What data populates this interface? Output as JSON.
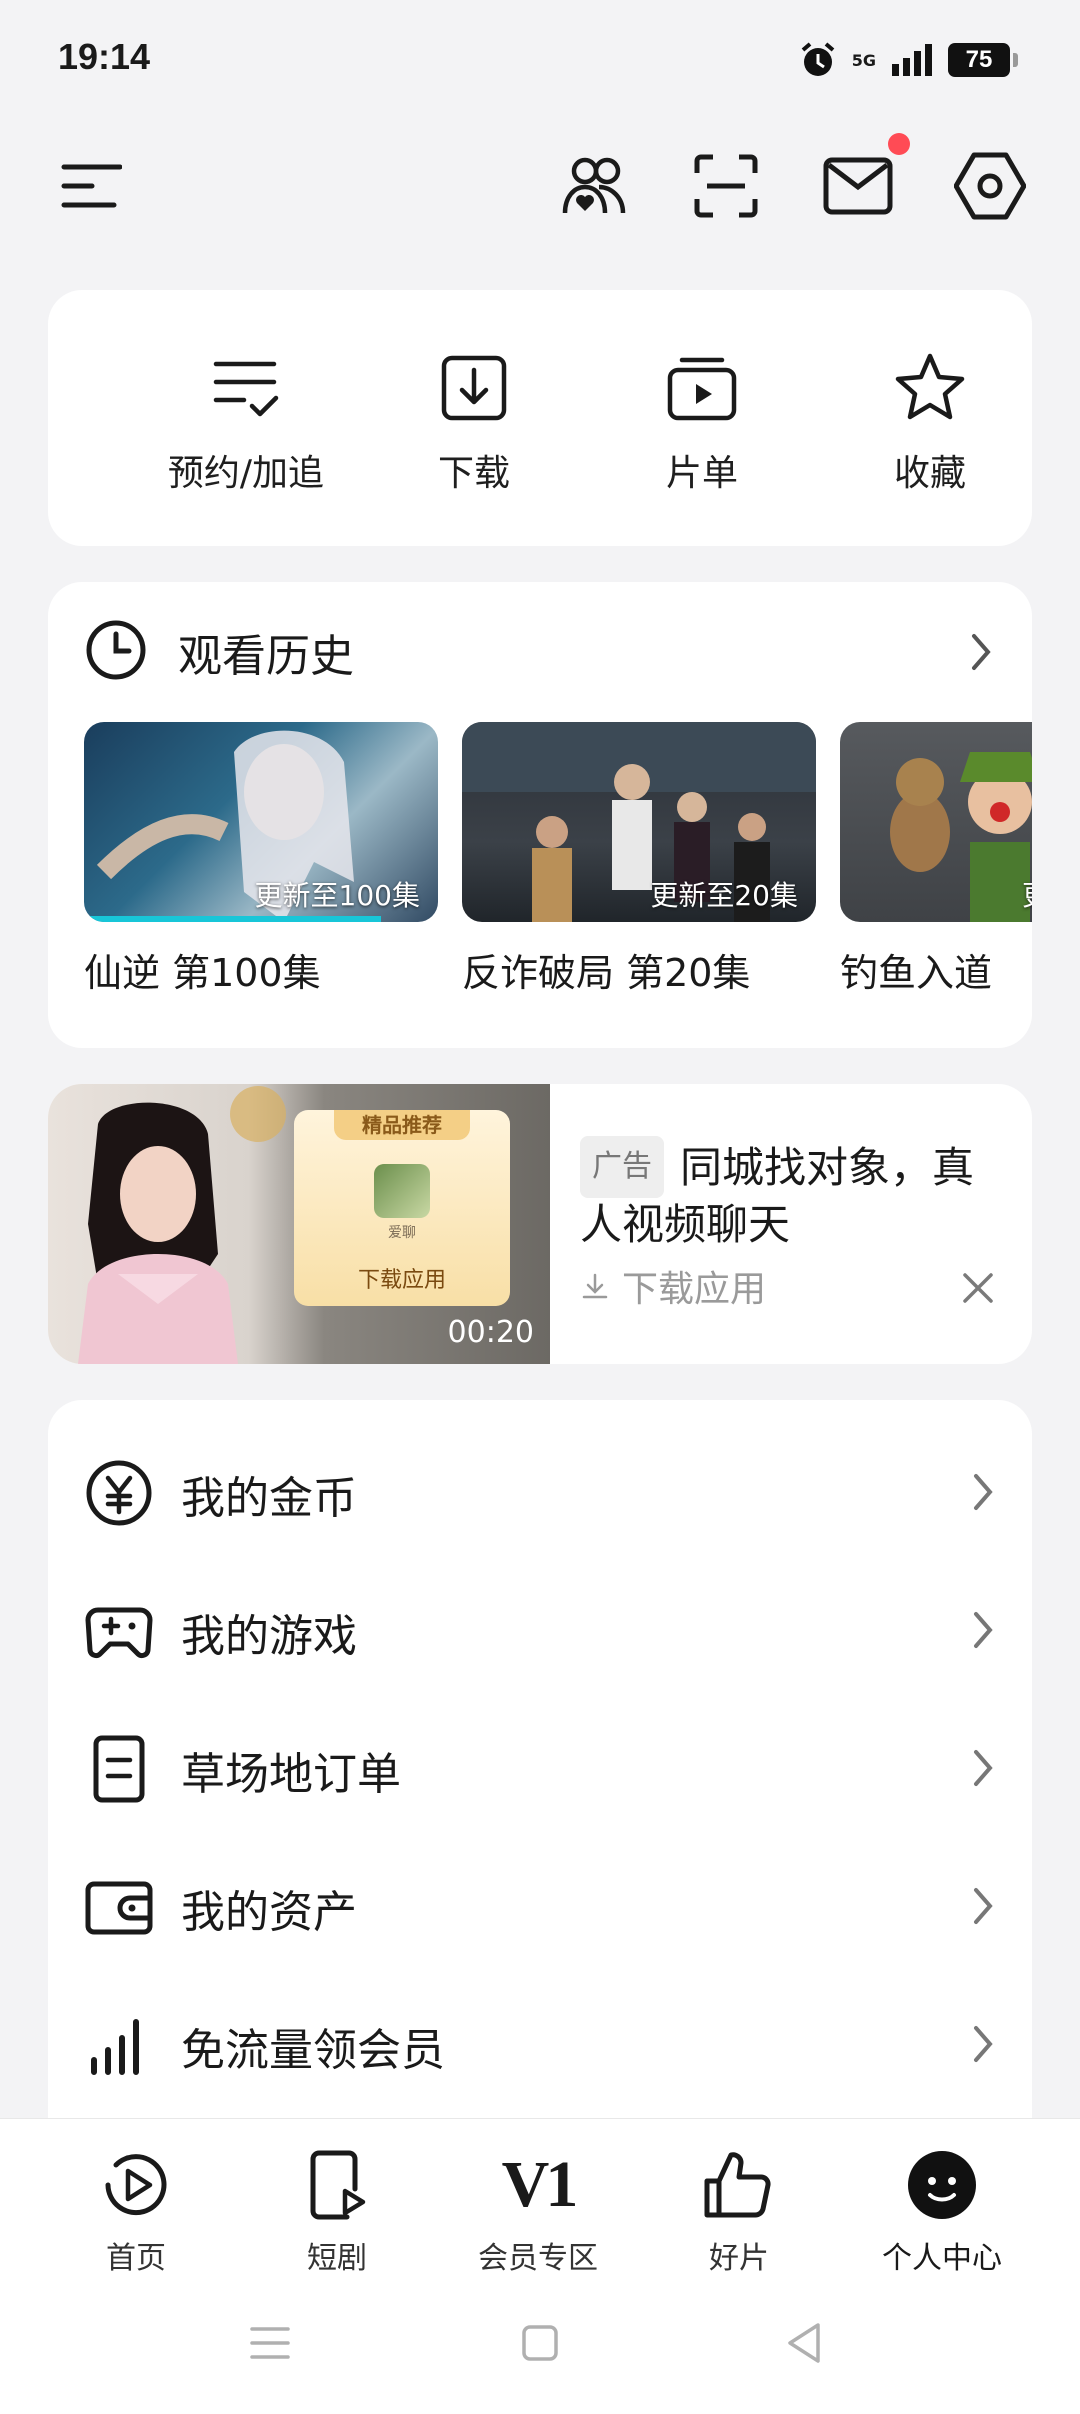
{
  "status_bar": {
    "time": "19:14",
    "network": "5G",
    "battery": "75"
  },
  "topbar": {
    "icons": [
      "menu-icon",
      "friends-icon",
      "scan-icon",
      "mail-icon",
      "settings-icon"
    ],
    "mail_has_badge": true
  },
  "quick_actions": [
    {
      "label": "预约/加追",
      "icon": "list-check-icon"
    },
    {
      "label": "下载",
      "icon": "download-icon"
    },
    {
      "label": "片单",
      "icon": "playlist-icon"
    },
    {
      "label": "收藏",
      "icon": "star-icon"
    }
  ],
  "history": {
    "title": "观看历史",
    "items": [
      {
        "caption": "仙逆 第100集",
        "overlay": "更新至100集",
        "progress": 0.84
      },
      {
        "caption": "反诈破局 第20集",
        "overlay": "更新至20集",
        "progress": 0
      },
      {
        "caption": "钓鱼入道",
        "overlay": "更",
        "progress": 0
      }
    ]
  },
  "ad": {
    "tag": "广告",
    "title": "同城找对象，真人视频聊天",
    "download_label": "下载应用",
    "duration": "00:20",
    "card_header": "精品推荐",
    "card_app": "爱聊",
    "card_button": "下载应用"
  },
  "menu": [
    {
      "label": "我的金币",
      "icon": "coin-icon"
    },
    {
      "label": "我的游戏",
      "icon": "gamepad-icon"
    },
    {
      "label": "草场地订单",
      "icon": "order-icon"
    },
    {
      "label": "我的资产",
      "icon": "wallet-icon"
    },
    {
      "label": "免流量领会员",
      "icon": "signal-icon"
    }
  ],
  "bottom_nav": [
    {
      "label": "首页",
      "icon": "play-home-icon"
    },
    {
      "label": "短剧",
      "icon": "short-drama-icon"
    },
    {
      "label": "会员专区",
      "icon": "vip-icon",
      "icon_text": "V1"
    },
    {
      "label": "好片",
      "icon": "thumbs-up-icon"
    },
    {
      "label": "个人中心",
      "icon": "profile-icon",
      "active": true
    }
  ]
}
